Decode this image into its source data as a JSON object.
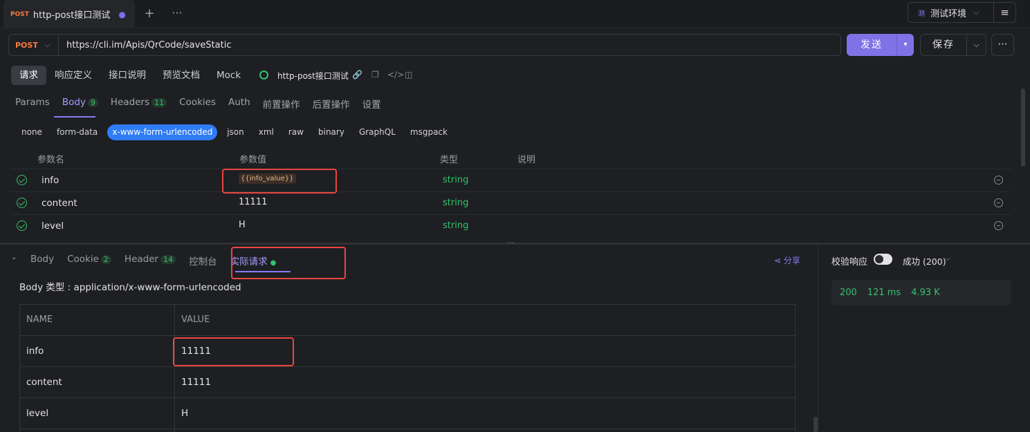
{
  "tab": {
    "method": "POST",
    "title": "http-post接口测试",
    "unsaved_dot": "●",
    "add": "+",
    "more": "···"
  },
  "env": {
    "icon": "测",
    "label": "测试环境",
    "chevron": "⌵",
    "menu": "≡"
  },
  "request": {
    "method": "POST",
    "url": "https://cli.im/Apis/QrCode/saveStatic",
    "send_label": "发送",
    "save_label": "保存"
  },
  "mode_tabs": [
    "请求",
    "响应定义",
    "接口说明",
    "预览文档",
    "Mock"
  ],
  "api_name": "http-post接口测试",
  "req_tabs": [
    {
      "label": "Params",
      "count": ""
    },
    {
      "label": "Body",
      "count": "9"
    },
    {
      "label": "Headers",
      "count": "11"
    },
    {
      "label": "Cookies",
      "count": ""
    },
    {
      "label": "Auth",
      "count": ""
    },
    {
      "label": "前置操作",
      "count": ""
    },
    {
      "label": "后置操作",
      "count": ""
    },
    {
      "label": "设置",
      "count": ""
    }
  ],
  "body_types": [
    "none",
    "form-data",
    "x-www-form-urlencoded",
    "json",
    "xml",
    "raw",
    "binary",
    "GraphQL",
    "msgpack"
  ],
  "params_headers": {
    "name": "参数名",
    "value": "参数值",
    "type": "类型",
    "desc": "说明"
  },
  "params": [
    {
      "name": "info",
      "value": "{{info_value}}",
      "type": "string"
    },
    {
      "name": "content",
      "value": "11111",
      "type": "string"
    },
    {
      "name": "level",
      "value": "H",
      "type": "string"
    }
  ],
  "response": {
    "tabs": [
      {
        "label": "Body",
        "count": ""
      },
      {
        "label": "Cookie",
        "count": "2"
      },
      {
        "label": "Header",
        "count": "14"
      },
      {
        "label": "控制台",
        "count": ""
      },
      {
        "label": "实际请求",
        "count": ""
      }
    ],
    "share": "分享",
    "body_type_line": "Body 类型 : application/x-www-form-urlencoded",
    "table_headers": {
      "name": "NAME",
      "value": "VALUE"
    },
    "rows": [
      {
        "name": "info",
        "value": "11111"
      },
      {
        "name": "content",
        "value": "11111"
      },
      {
        "name": "level",
        "value": "H"
      }
    ]
  },
  "side": {
    "verify_label": "校验响应",
    "verify_on": true,
    "status": "成功 (200)",
    "code": "200",
    "time": "121 ms",
    "size": "4.93 K"
  }
}
